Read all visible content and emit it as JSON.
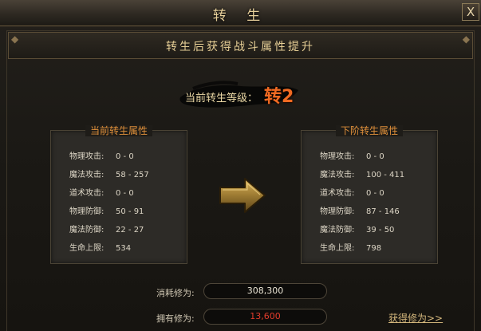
{
  "window": {
    "title": "转 生",
    "close_label": "X"
  },
  "header": {
    "subtitle": "转生后获得战斗属性提升"
  },
  "rebirth": {
    "label": "当前转生等级：",
    "value": "转2"
  },
  "current_panel": {
    "title": "当前转生属性",
    "stats": [
      {
        "name": "物理攻击:",
        "value": "0 - 0"
      },
      {
        "name": "魔法攻击:",
        "value": "58 - 257"
      },
      {
        "name": "道术攻击:",
        "value": "0 - 0"
      },
      {
        "name": "物理防御:",
        "value": "50 - 91"
      },
      {
        "name": "魔法防御:",
        "value": "22 - 27"
      },
      {
        "name": "生命上限:",
        "value": "534"
      }
    ]
  },
  "next_panel": {
    "title": "下阶转生属性",
    "stats": [
      {
        "name": "物理攻击:",
        "value": "0 - 0"
      },
      {
        "name": "魔法攻击:",
        "value": "100 - 411"
      },
      {
        "name": "道术攻击:",
        "value": "0 - 0"
      },
      {
        "name": "物理防御:",
        "value": "87 - 146"
      },
      {
        "name": "魔法防御:",
        "value": "39 - 50"
      },
      {
        "name": "生命上限:",
        "value": "798"
      }
    ]
  },
  "cost": {
    "label": "消耗修为:",
    "value": "308,300"
  },
  "owned": {
    "label": "拥有修为:",
    "value": "13,600"
  },
  "obtain_link": "获得修为>>",
  "icons": {
    "arrow": "right-arrow-icon",
    "close": "close-icon"
  },
  "colors": {
    "accent_title": "#e7cf96",
    "panel_title": "#df8f3a",
    "level_value": "#f06a22",
    "owned_value": "#e23c2c"
  }
}
